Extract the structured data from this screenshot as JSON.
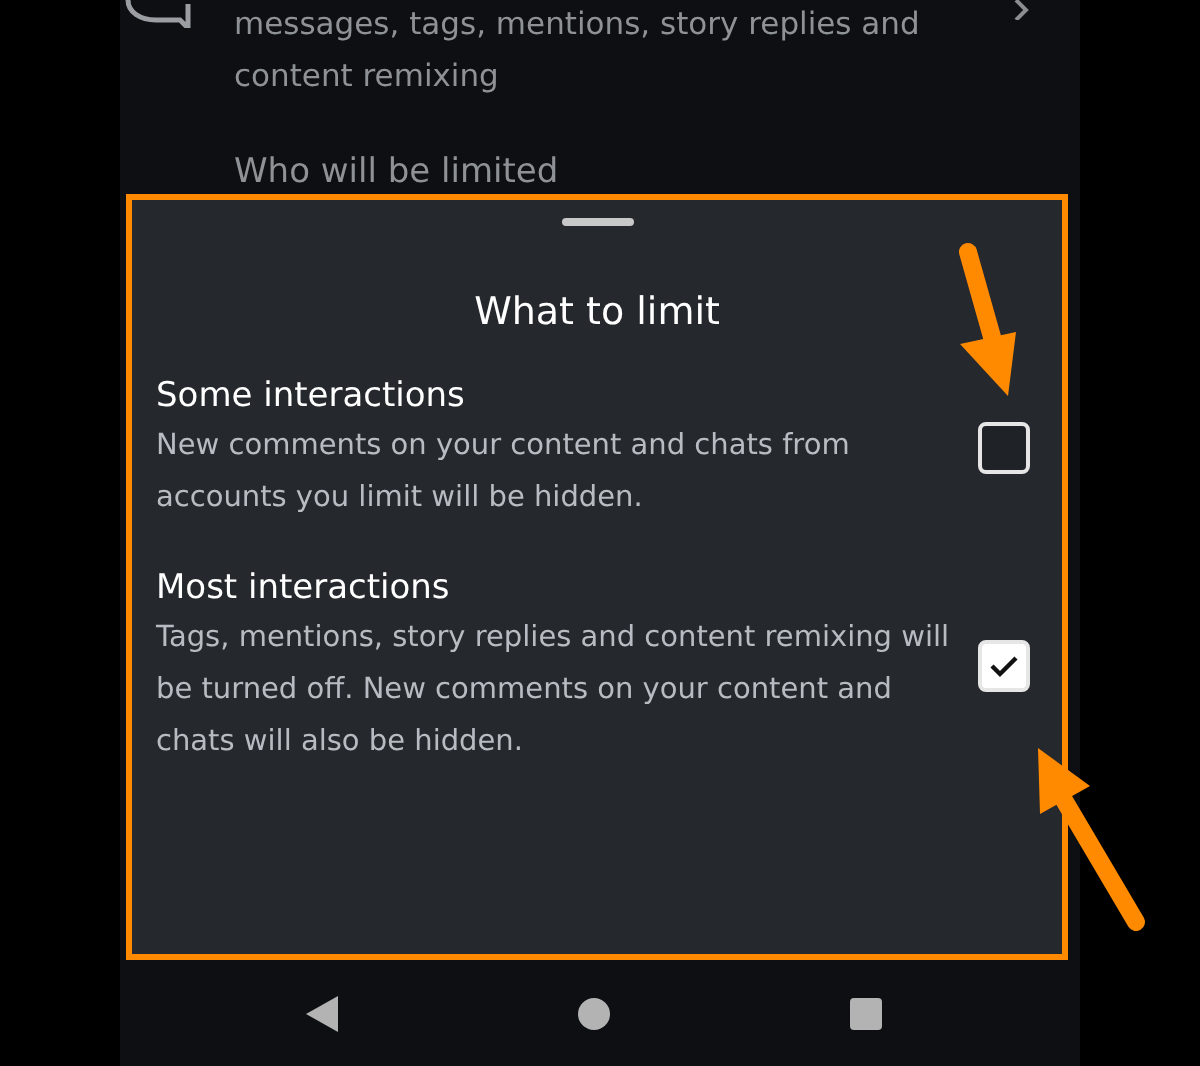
{
  "background_screen": {
    "description": "messages, tags, mentions, story replies and content remixing",
    "section_heading": "Who will be limited"
  },
  "sheet": {
    "title": "What to limit",
    "options": [
      {
        "title": "Some interactions",
        "description": "New comments on your content and chats from accounts you limit will be hidden.",
        "checked": false
      },
      {
        "title": "Most interactions",
        "description": "Tags, mentions, story replies and content remixing will be turned off. New comments on your content and chats will also be hidden.",
        "checked": true
      }
    ]
  }
}
